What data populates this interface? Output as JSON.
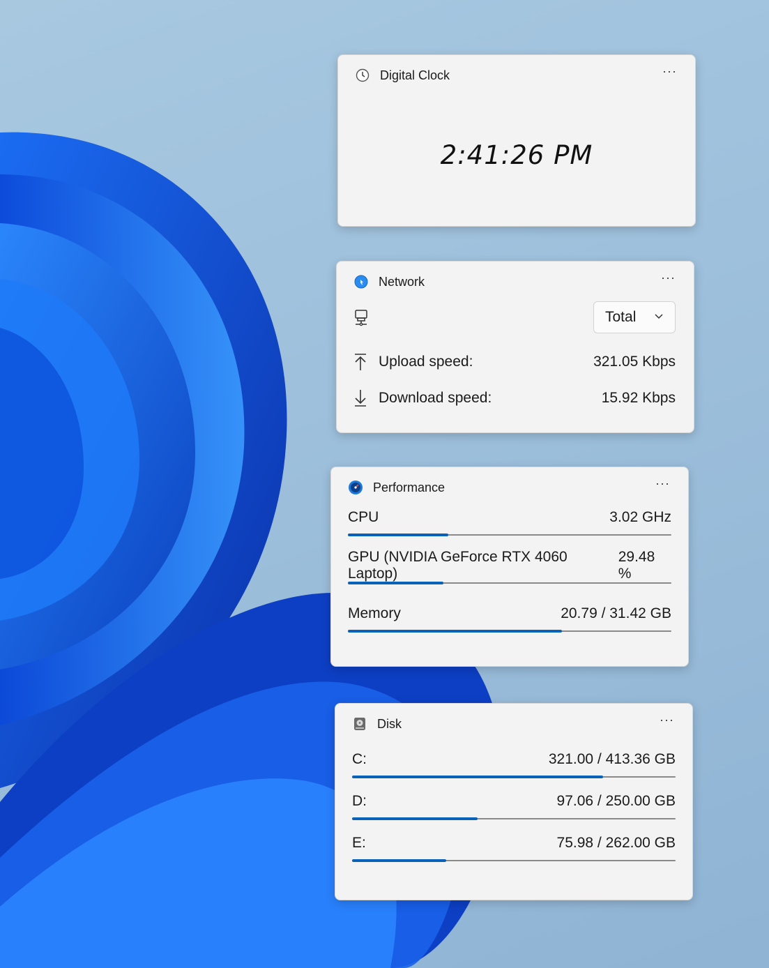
{
  "clock": {
    "title": "Digital Clock",
    "time": "2:41:26 PM",
    "more": "···"
  },
  "network": {
    "title": "Network",
    "more": "···",
    "dropdown_value": "Total",
    "upload_label": "Upload speed:",
    "upload_value": "321.05 Kbps",
    "download_label": "Download speed:",
    "download_value": "15.92 Kbps"
  },
  "performance": {
    "title": "Performance",
    "more": "···",
    "metrics": [
      {
        "label": "CPU",
        "value": "3.02 GHz",
        "fill": 0.31
      },
      {
        "label": "GPU (NVIDIA GeForce RTX 4060 Laptop)",
        "value": "29.48 %",
        "fill": 0.2948
      },
      {
        "label": "Memory",
        "value": "20.79 / 31.42 GB",
        "fill": 0.6617
      }
    ]
  },
  "disk": {
    "title": "Disk",
    "more": "···",
    "drives": [
      {
        "label": "C:",
        "value": "321.00 / 413.36 GB",
        "fill": 0.7766
      },
      {
        "label": "D:",
        "value": "97.06 / 250.00 GB",
        "fill": 0.3882
      },
      {
        "label": "E:",
        "value": "75.98 / 262.00 GB",
        "fill": 0.29
      }
    ]
  },
  "colors": {
    "accent": "#0a62b8",
    "widget_bg": "#f3f3f3"
  }
}
